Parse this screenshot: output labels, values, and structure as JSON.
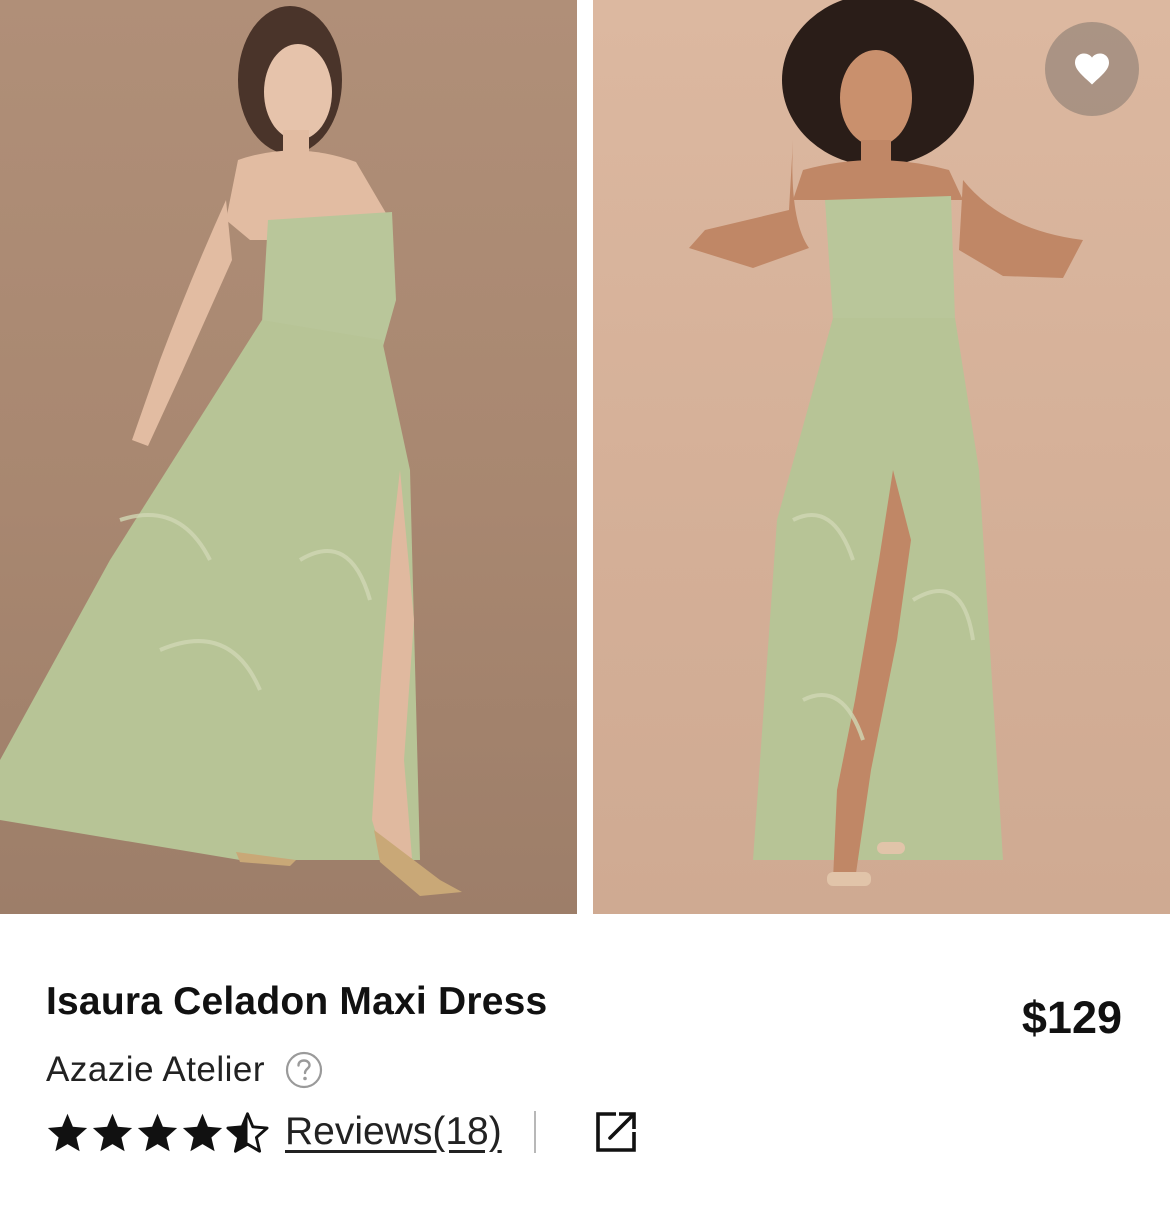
{
  "product": {
    "name": "Isaura Celadon Maxi Dress",
    "brand": "Azazie Atelier",
    "price": "$129",
    "rating": 4.5,
    "reviews_label": "Reviews(18)"
  },
  "icons": {
    "favorite": "heart-icon",
    "help": "question-circle-icon",
    "share": "external-link-icon",
    "rating": "star-icon"
  },
  "colors": {
    "dress": "#b7c496",
    "background_left": "#a88770",
    "background_right": "#d4af97",
    "text": "#111111"
  }
}
